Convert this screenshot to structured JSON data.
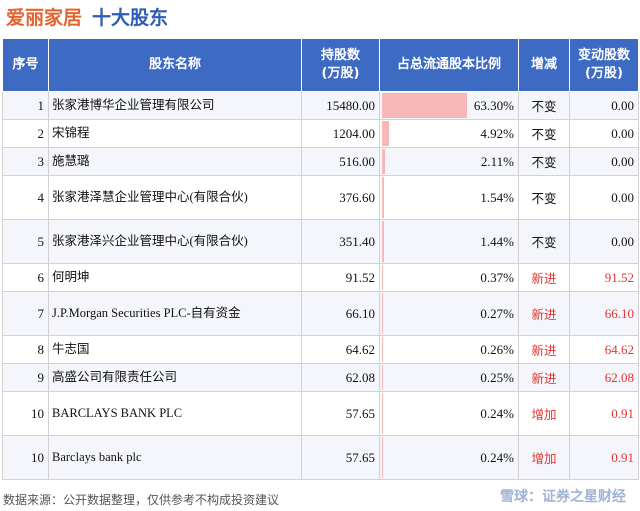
{
  "header": {
    "company": "爱丽家居",
    "subtitle": "十大股东"
  },
  "columns": {
    "index": "序号",
    "name": "股东名称",
    "shares_line1": "持股数",
    "shares_line2": "(万股)",
    "ratio": "占总流通股本比例",
    "status": "增减",
    "change_line1": "变动股数",
    "change_line2": "(万股)"
  },
  "rows": [
    {
      "index": "1",
      "name": "张家港博华企业管理有限公司",
      "shares": "15480.00",
      "ratio": "63.30%",
      "ratio_value": 63.3,
      "status": "不变",
      "change": "0.00"
    },
    {
      "index": "2",
      "name": "宋锦程",
      "shares": "1204.00",
      "ratio": "4.92%",
      "ratio_value": 4.92,
      "status": "不变",
      "change": "0.00"
    },
    {
      "index": "3",
      "name": "施慧璐",
      "shares": "516.00",
      "ratio": "2.11%",
      "ratio_value": 2.11,
      "status": "不变",
      "change": "0.00"
    },
    {
      "index": "4",
      "name": "张家港泽慧企业管理中心(有限合伙)",
      "shares": "376.60",
      "ratio": "1.54%",
      "ratio_value": 1.54,
      "status": "不变",
      "change": "0.00"
    },
    {
      "index": "5",
      "name": "张家港泽兴企业管理中心(有限合伙)",
      "shares": "351.40",
      "ratio": "1.44%",
      "ratio_value": 1.44,
      "status": "不变",
      "change": "0.00"
    },
    {
      "index": "6",
      "name": "何明坤",
      "shares": "91.52",
      "ratio": "0.37%",
      "ratio_value": 0.37,
      "status": "新进",
      "change": "91.52"
    },
    {
      "index": "7",
      "name": "J.P.Morgan Securities PLC-自有资金",
      "shares": "66.10",
      "ratio": "0.27%",
      "ratio_value": 0.27,
      "status": "新进",
      "change": "66.10"
    },
    {
      "index": "8",
      "name": "牛志国",
      "shares": "64.62",
      "ratio": "0.26%",
      "ratio_value": 0.26,
      "status": "新进",
      "change": "64.62"
    },
    {
      "index": "9",
      "name": "高盛公司有限责任公司",
      "shares": "62.08",
      "ratio": "0.25%",
      "ratio_value": 0.25,
      "status": "新进",
      "change": "62.08"
    },
    {
      "index": "10",
      "name": "BARCLAYS BANK PLC",
      "shares": "57.65",
      "ratio": "0.24%",
      "ratio_value": 0.24,
      "status": "增加",
      "change": "0.91"
    },
    {
      "index": "10",
      "name": "Barclays bank plc",
      "shares": "57.65",
      "ratio": "0.24%",
      "ratio_value": 0.24,
      "status": "增加",
      "change": "0.91"
    }
  ],
  "footer": {
    "source": "数据来源：公开数据整理，仅供参考不构成投资建议",
    "brand": "雪球：证券之星财经"
  },
  "colors": {
    "header_bg": "#3d6ac2",
    "bar": "#f8b8b8",
    "accent_red": "#e3342f",
    "company": "#e3642f",
    "subtitle": "#2e5bb5"
  }
}
